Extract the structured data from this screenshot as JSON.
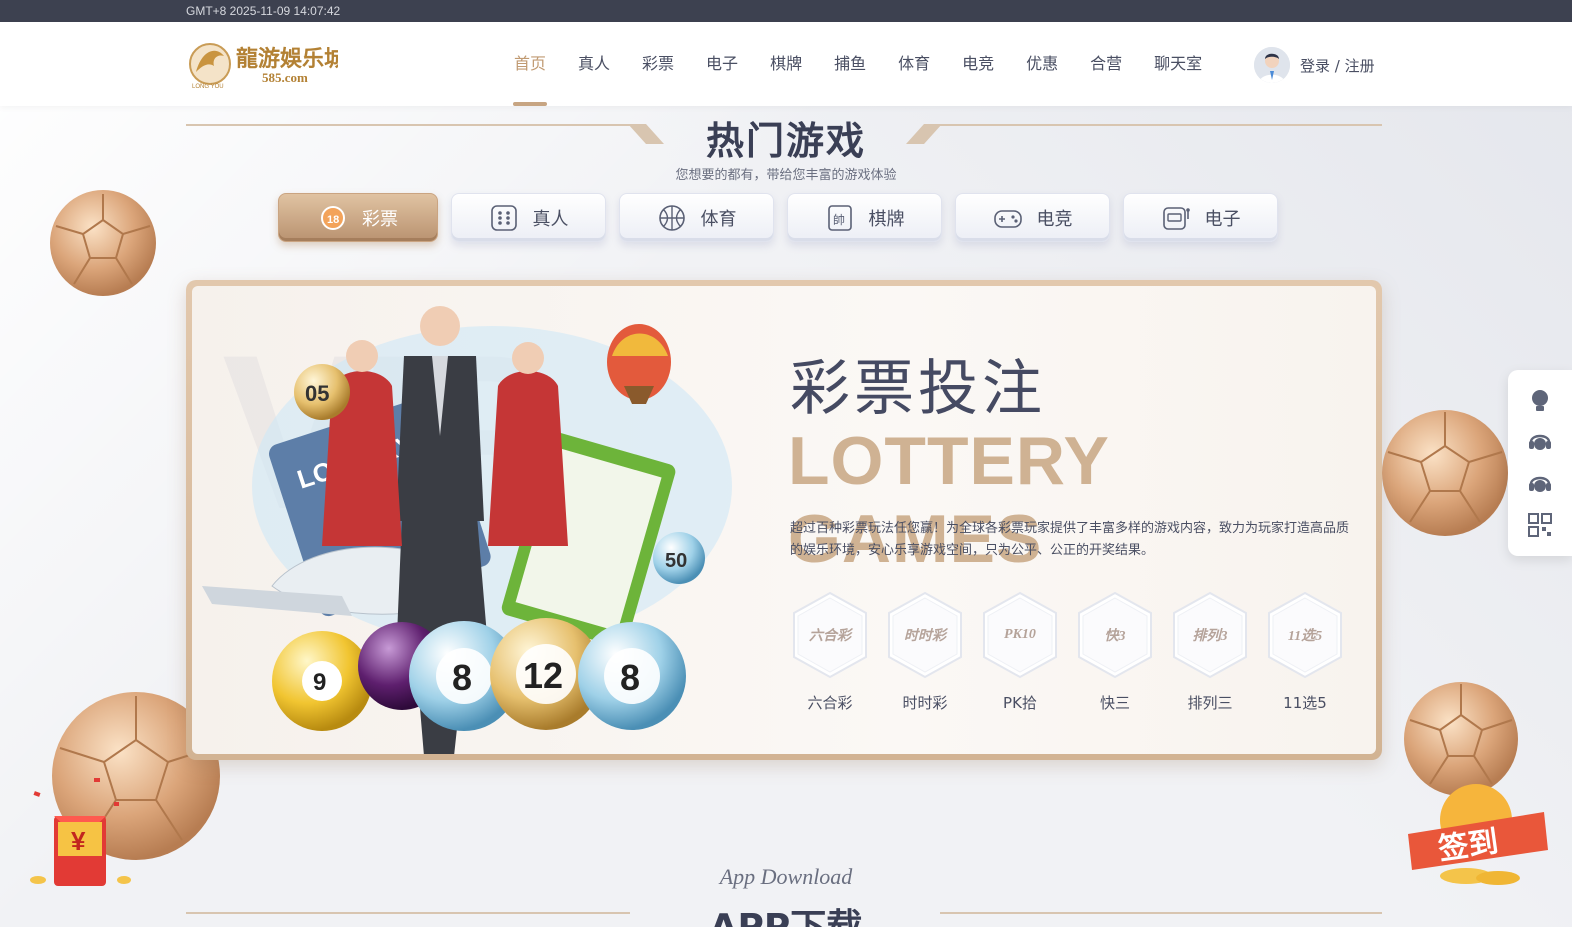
{
  "topbar": {
    "time": "GMT+8 2025-11-09 14:07:42"
  },
  "logo": {
    "text_cn": "龍游娛乐城",
    "text_domain": "585.com",
    "text_en": "LONG YOU"
  },
  "nav": {
    "items": [
      {
        "label": "首页",
        "active": true
      },
      {
        "label": "真人"
      },
      {
        "label": "彩票"
      },
      {
        "label": "电子"
      },
      {
        "label": "棋牌"
      },
      {
        "label": "捕鱼"
      },
      {
        "label": "体育"
      },
      {
        "label": "电竞"
      },
      {
        "label": "优惠"
      },
      {
        "label": "合营"
      },
      {
        "label": "聊天室"
      }
    ]
  },
  "user": {
    "login_label": "登录 / 注册"
  },
  "section": {
    "title": "热门游戏",
    "subtitle": "您想要的都有，带给您丰富的游戏体验"
  },
  "tabs": [
    {
      "label": "彩票",
      "icon": "lottery-icon",
      "active": true
    },
    {
      "label": "真人",
      "icon": "dice-icon"
    },
    {
      "label": "体育",
      "icon": "basketball-icon"
    },
    {
      "label": "棋牌",
      "icon": "chess-card-icon"
    },
    {
      "label": "电竞",
      "icon": "gamepad-icon"
    },
    {
      "label": "电子",
      "icon": "slot-machine-icon"
    }
  ],
  "card": {
    "title_cn": "彩票投注",
    "title_en": "LOTTERY GAMES",
    "description": "超过百种彩票玩法任您赢！为全球各彩票玩家提供了丰富多样的游戏内容，致力为玩家打造高品质的娱乐环境，安心乐享游戏空间，只为公平、公正的开奖结果。",
    "hero_balls": [
      "9",
      "8",
      "12",
      "8"
    ],
    "hero_small_balls": [
      "05",
      "50"
    ],
    "hero_sign": "LOTTERY",
    "games": [
      {
        "name": "六合彩",
        "logo": "六合彩"
      },
      {
        "name": "时时彩",
        "logo": "时时彩"
      },
      {
        "name": "PK拾",
        "logo": "PK10"
      },
      {
        "name": "快三",
        "logo": "快3"
      },
      {
        "name": "排列三",
        "logo": "排列3"
      },
      {
        "name": "11选5",
        "logo": "11选5"
      }
    ]
  },
  "side_panel": {
    "icons": [
      "lightbulb-icon",
      "customer-service-icon",
      "customer-service-2-icon",
      "qrcode-icon"
    ]
  },
  "app": {
    "subtitle": "App Download",
    "title": "APP下载"
  },
  "signin": {
    "label": "签到"
  },
  "redpacket": {
    "label": "¥"
  },
  "colors": {
    "accent": "#c7a582",
    "dark": "#3d4150",
    "text": "#4a4f63"
  }
}
